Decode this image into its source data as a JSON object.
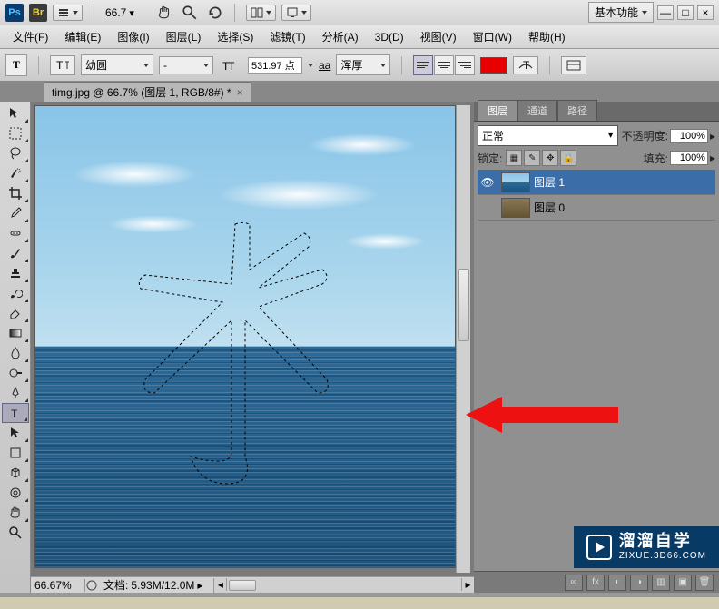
{
  "app_bar": {
    "ps": "Ps",
    "br": "Br",
    "zoom": "66.7",
    "workspace": "基本功能"
  },
  "menu": {
    "file": "文件(F)",
    "edit": "编辑(E)",
    "image": "图像(I)",
    "layer": "图层(L)",
    "select": "选择(S)",
    "filter": "滤镜(T)",
    "analysis": "分析(A)",
    "threed": "3D(D)",
    "view": "视图(V)",
    "window": "窗口(W)",
    "help": "帮助(H)"
  },
  "options": {
    "tool_glyph": "T",
    "font_family": "幼圆",
    "font_style": "-",
    "font_size": "531.97 点",
    "aa_label": "aa",
    "aa_value": "浑厚",
    "color": "#e60000"
  },
  "doc_tab": {
    "label": "timg.jpg @ 66.7% (图层 1, RGB/8#) *"
  },
  "status": {
    "zoom": "66.67%",
    "doc_label": "文档:",
    "doc_value": "5.93M/12.0M"
  },
  "panels": {
    "tabs": {
      "layers": "图层",
      "channels": "通道",
      "paths": "路径"
    },
    "blend_mode": "正常",
    "opacity_label": "不透明度:",
    "opacity_value": "100%",
    "lock_label": "锁定:",
    "fill_label": "填充:",
    "fill_value": "100%",
    "layers": [
      {
        "name": "图层 1",
        "visible": true,
        "selected": true
      },
      {
        "name": "图层 0",
        "visible": false,
        "selected": false
      }
    ]
  },
  "watermark": {
    "big": "溜溜自学",
    "small": "ZIXUE.3D66.COM"
  }
}
